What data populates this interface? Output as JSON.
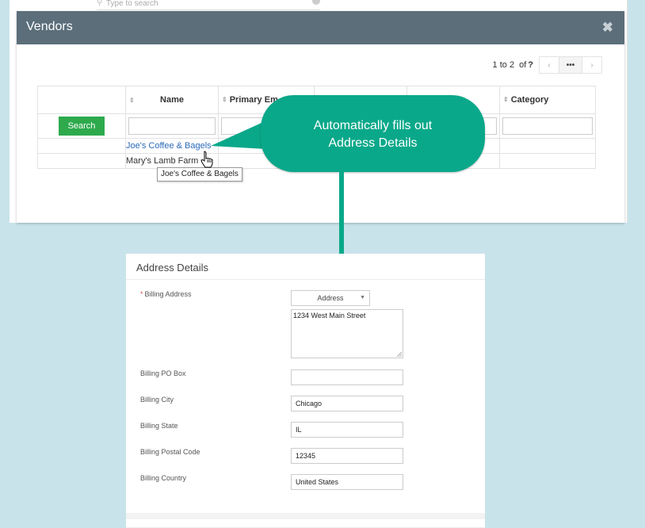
{
  "background": {
    "search_placeholder": "Type to search"
  },
  "modal": {
    "title": "Vendors",
    "close_icon": "close-icon",
    "pager": {
      "info": "1 to 2",
      "of_label": "of",
      "total": "?",
      "more_label": "•••"
    },
    "grid": {
      "columns": [
        "",
        "Name",
        "Primary Em",
        "",
        "",
        "Category"
      ],
      "search_label": "Search",
      "rows": [
        {
          "name": "Joe's Coffee & Bagels"
        },
        {
          "name": "Mary's Lamb Farm"
        }
      ]
    },
    "tooltip": "Joe's Coffee & Bagels"
  },
  "callout": {
    "line1": "Automatically fills out",
    "line2": "Address Details",
    "color": "#0aa88a"
  },
  "address": {
    "title": "Address Details",
    "billing_address_label": "Billing Address",
    "address_type": "Address",
    "street": "1234 West Main Street",
    "po_box_label": "Billing PO Box",
    "po_box": "",
    "city_label": "Billing City",
    "city": "Chicago",
    "state_label": "Billing State",
    "state": "IL",
    "postal_label": "Billing Postal Code",
    "postal": "12345",
    "country_label": "Billing Country",
    "country": "United States"
  },
  "colors": {
    "header": "#5b6e7a",
    "search_button": "#2eaa4d",
    "link": "#2a6ab8",
    "required": "#d9534f"
  }
}
